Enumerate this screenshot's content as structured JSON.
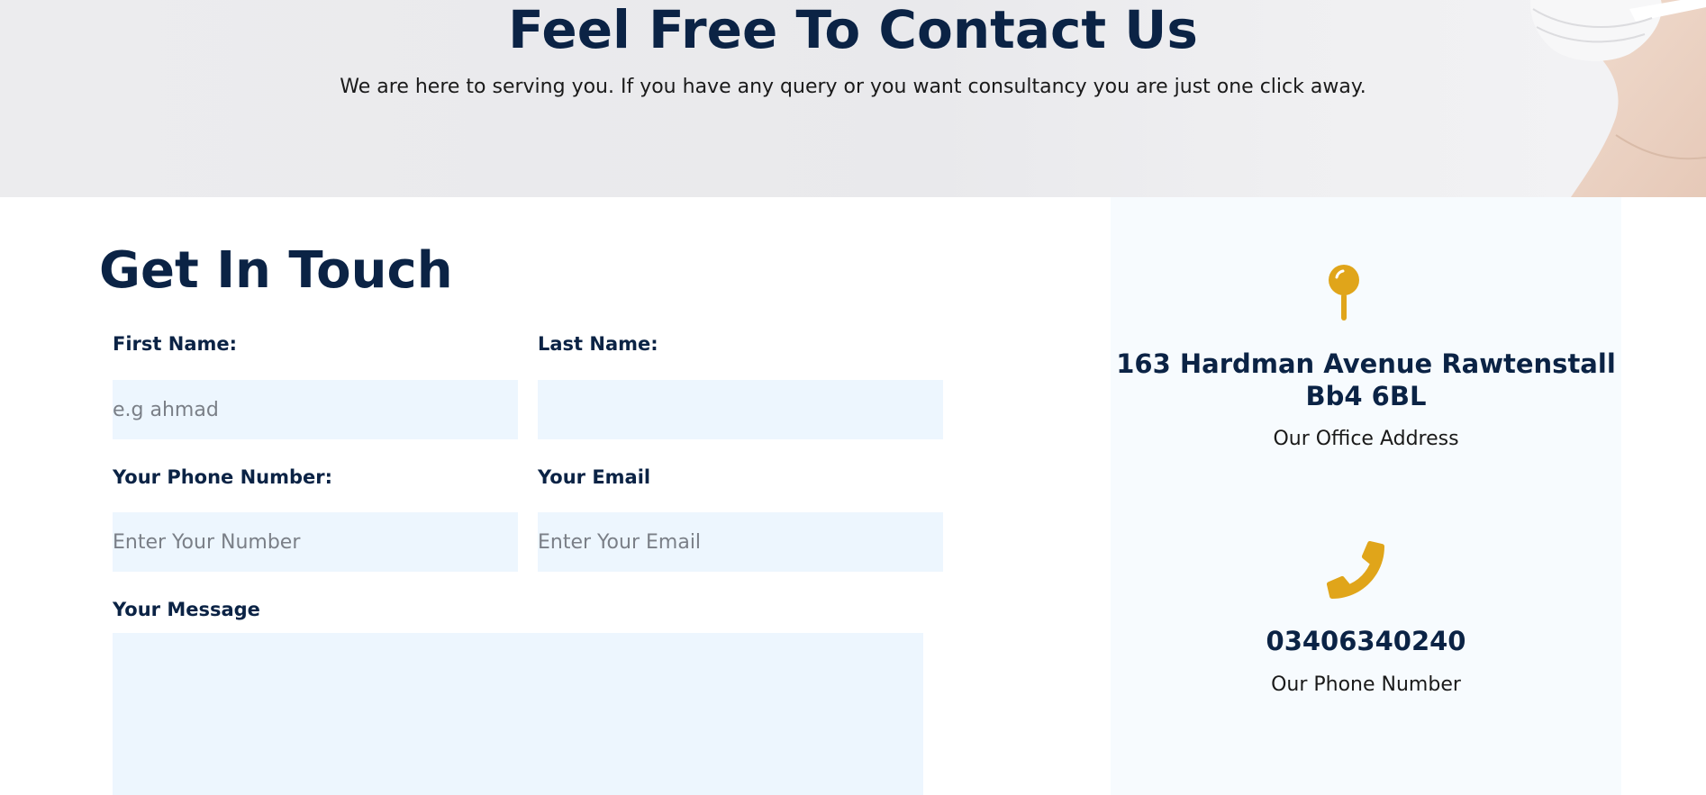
{
  "hero": {
    "title": "Feel Free To Contact Us",
    "subtitle": "We are here to serving you. If you have any query or you want consultancy you are just one click away."
  },
  "form": {
    "title": "Get In Touch",
    "first_name_label": "First Name:",
    "first_name_placeholder": "e.g ahmad",
    "last_name_label": "Last Name:",
    "last_name_placeholder": "",
    "phone_label": "Your Phone Number:",
    "phone_placeholder": "Enter Your Number",
    "email_label": "Your Email",
    "email_placeholder": "Enter Your Email",
    "message_label": "Your Message",
    "message_placeholder": ""
  },
  "info": {
    "address": "163 Hardman Avenue Rawtenstall Bb4 6BL",
    "address_caption": "Our Office Address",
    "address_icon": "map-pin-icon",
    "phone": "03406340240",
    "phone_caption": "Our Phone Number",
    "phone_icon": "phone-icon"
  },
  "colors": {
    "heading": "#0b2345",
    "accent": "#e0a51a",
    "field_bg": "#edf6fe",
    "panel_bg": "#f7fbfe"
  }
}
